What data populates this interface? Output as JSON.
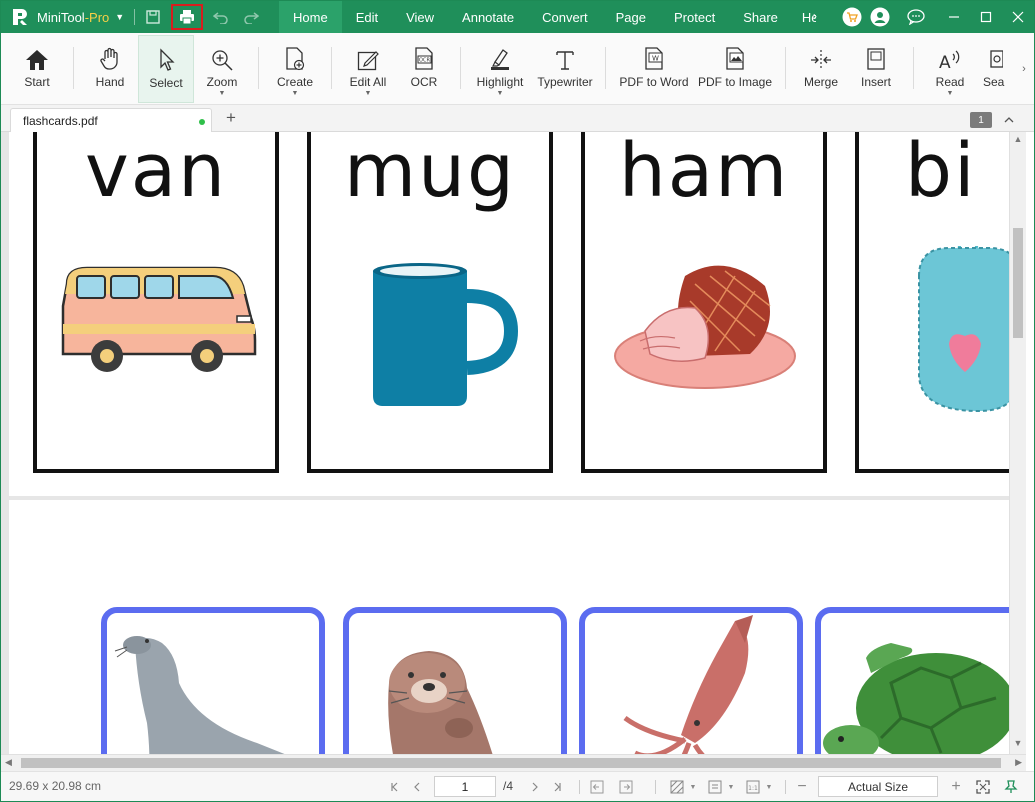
{
  "titlebar": {
    "app_name": "MiniTool",
    "app_edition": "-Pro",
    "menu": [
      "Home",
      "Edit",
      "View",
      "Annotate",
      "Convert",
      "Page",
      "Protect",
      "Share",
      "Help"
    ],
    "active_menu": "Home"
  },
  "ribbon": {
    "start": "Start",
    "hand": "Hand",
    "select": "Select",
    "zoom": "Zoom",
    "create": "Create",
    "edit_all": "Edit All",
    "ocr": "OCR",
    "highlight": "Highlight",
    "typewriter": "Typewriter",
    "pdf_to_word": "PDF to Word",
    "pdf_to_image": "PDF to Image",
    "merge": "Merge",
    "insert": "Insert",
    "read": "Read",
    "search": "Sea"
  },
  "tabs": {
    "doc_name": "flashcards.pdf",
    "page_badge": "1"
  },
  "document": {
    "page1_words": [
      "van",
      "mug",
      "ham",
      "bi"
    ]
  },
  "statusbar": {
    "page_size": "29.69 x 20.98 cm",
    "current_page": "1",
    "total_pages": "/4",
    "zoom_mode": "Actual Size"
  },
  "colors": {
    "accent": "#1f8f5a",
    "card_border_blue": "#5b6cf0"
  }
}
